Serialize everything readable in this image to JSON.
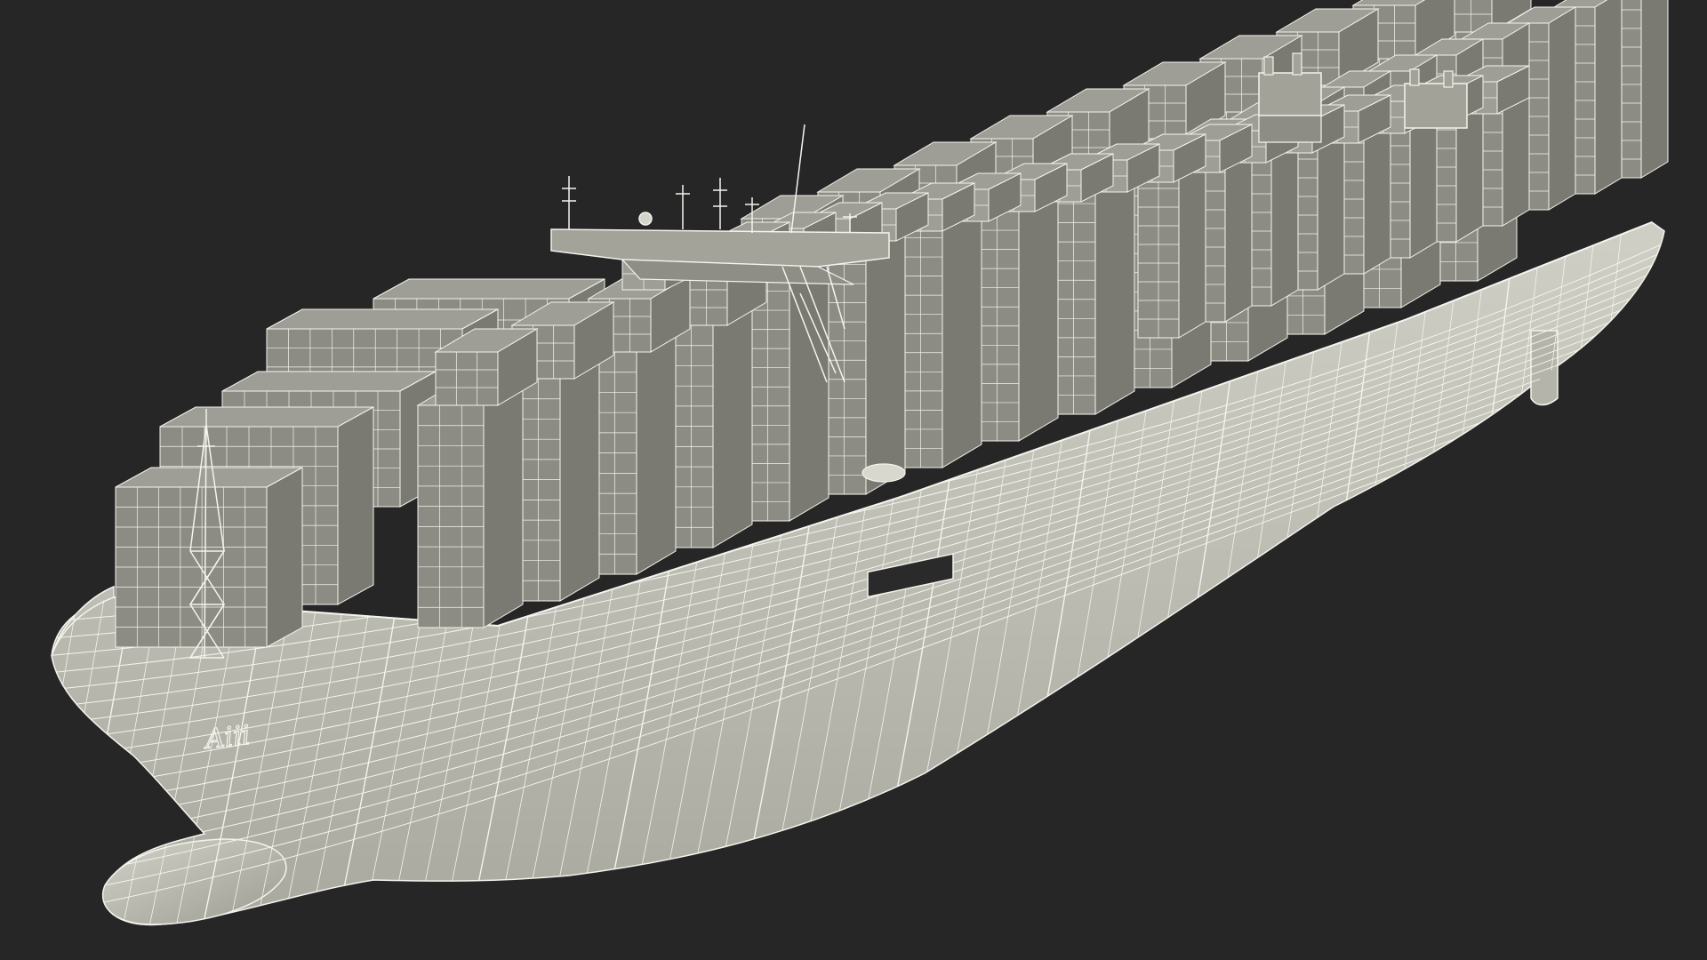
{
  "scene": {
    "subject": "container-ship-wireframe-model",
    "background_color": "#262626",
    "hull_color": "#c9c9be",
    "hull_shade_color": "#a8a89e",
    "container_color": "#8c8c84",
    "container_side_color": "#7a7a73",
    "container_top_color": "#9e9e96",
    "wire_color": "#f4f4ee",
    "hull_marking": "Aiii"
  }
}
